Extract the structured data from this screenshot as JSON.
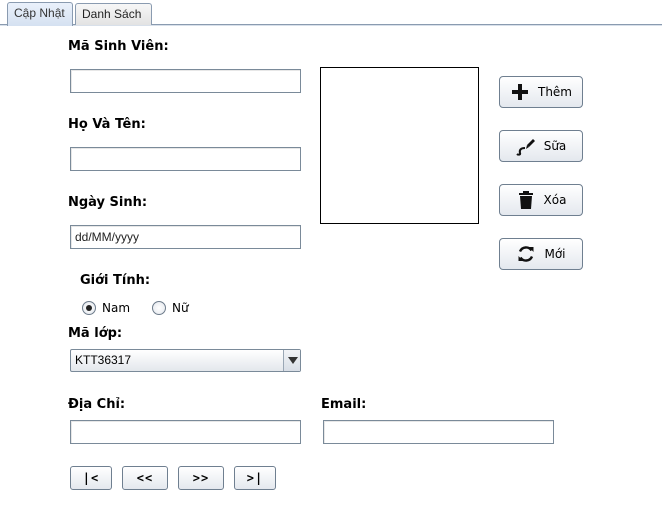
{
  "tabs": [
    {
      "label": "Cập Nhật",
      "active": true
    },
    {
      "label": "Danh Sách",
      "active": false
    }
  ],
  "form": {
    "student_id_label": "Mã Sinh Viên:",
    "student_id_value": "",
    "name_label": "Họ Và Tên:",
    "name_value": "",
    "birthdate_label": "Ngày Sinh:",
    "birthdate_placeholder": "dd/MM/yyyy",
    "gender_label": "Giới Tính:",
    "gender_options": [
      {
        "label": "Nam",
        "selected": true
      },
      {
        "label": "Nữ",
        "selected": false
      }
    ],
    "class_label": "Mã lớp:",
    "class_value": "KTT36317",
    "address_label": "Địa Chỉ:",
    "address_value": "",
    "email_label": "Email:",
    "email_value": ""
  },
  "actions": {
    "add_label": "Thêm",
    "edit_label": "Sữa",
    "delete_label": "Xóa",
    "new_label": "Mới"
  },
  "navigation": {
    "first_label": "|<",
    "prev_label": "<<",
    "next_label": ">>",
    "last_label": ">|"
  },
  "icons": {
    "add": "plus-icon",
    "edit": "edit-icon",
    "delete": "trash-icon",
    "new": "refresh-icon"
  }
}
